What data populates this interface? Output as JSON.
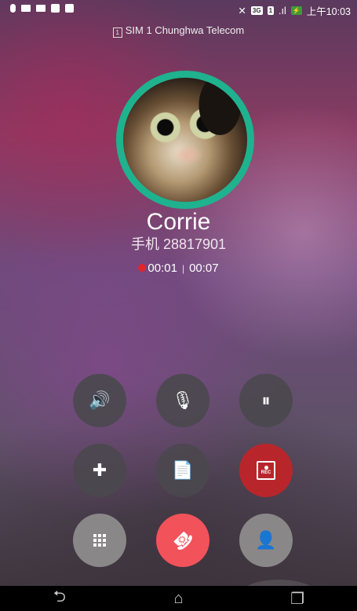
{
  "status": {
    "network": "3G",
    "sim_slot": "1",
    "time": "上午10:03"
  },
  "sim_line": {
    "slot": "1",
    "text": "SIM 1  Chunghwa Telecom"
  },
  "contact": {
    "name": "Corrie",
    "number": "手机 28817901"
  },
  "timers": {
    "record": "00:01",
    "separator": "|",
    "call": "00:07"
  },
  "buttons": [
    {
      "name": "speaker",
      "icon": "speaker-icon",
      "glyph": "🔊"
    },
    {
      "name": "mute",
      "icon": "mic-mute-icon",
      "glyph": "🎙"
    },
    {
      "name": "hold",
      "icon": "phone-pause-icon",
      "glyph": "⏸"
    },
    {
      "name": "add-call",
      "icon": "phone-add-icon",
      "glyph": "✚"
    },
    {
      "name": "note",
      "icon": "note-add-icon",
      "glyph": "📄"
    },
    {
      "name": "record",
      "icon": "rec-icon",
      "label": "REC"
    },
    {
      "name": "keypad",
      "icon": "dialpad-icon"
    },
    {
      "name": "end-call",
      "icon": "hangup-icon",
      "glyph": "☎"
    },
    {
      "name": "contact",
      "icon": "person-icon",
      "glyph": "👤"
    }
  ],
  "nav": {
    "back": "⮌",
    "home": "⌂",
    "recents": "❐"
  },
  "colors": {
    "ring": "#1fb28e",
    "end_call": "#f2525a",
    "record": "#b8262b"
  }
}
